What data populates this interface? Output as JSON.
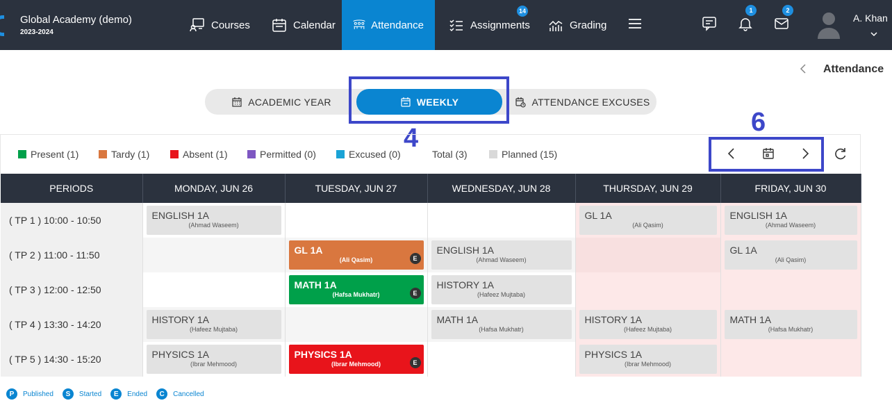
{
  "app": {
    "school_name": "Global Academy (demo)",
    "school_year": "2023-2024",
    "brand_color": "#0a85d1",
    "nav": [
      {
        "label": "Courses",
        "icon": "courses-icon"
      },
      {
        "label": "Calendar",
        "icon": "calendar-icon"
      },
      {
        "label": "Attendance",
        "icon": "attendance-icon",
        "active": true
      },
      {
        "label": "Assignments",
        "icon": "assignments-icon",
        "badge": "14"
      },
      {
        "label": "Grading",
        "icon": "grading-icon"
      }
    ],
    "header_badges": {
      "notifications": "1",
      "messages": "2"
    },
    "user_name": "A. Khan"
  },
  "breadcrumb": {
    "title": "Attendance"
  },
  "view_tabs": [
    {
      "label": "ACADEMIC YEAR",
      "icon": "calendar-grid-icon"
    },
    {
      "label": "WEEKLY",
      "icon": "calendar-icon",
      "active": true
    },
    {
      "label": "ATTENDANCE EXCUSES",
      "icon": "calendar-clock-icon"
    }
  ],
  "annotations": {
    "weekly": "4",
    "week_nav": "6"
  },
  "legend": [
    {
      "label": "Present (1)",
      "color": "#00a04a"
    },
    {
      "label": "Tardy (1)",
      "color": "#d9773f"
    },
    {
      "label": "Absent (1)",
      "color": "#e8141b"
    },
    {
      "label": "Permitted (0)",
      "color": "#7e57c2"
    },
    {
      "label": "Excused (0)",
      "color": "#1aa3d6"
    },
    {
      "label": "Total (3)",
      "color": ""
    },
    {
      "label": "Planned (15)",
      "color": "#d9d9d9"
    }
  ],
  "table": {
    "headers": [
      "PERIODS",
      "MONDAY, JUN 26",
      "TUESDAY, JUN 27",
      "WEDNESDAY, JUN 28",
      "THURSDAY, JUN 29",
      "FRIDAY, JUN 30"
    ],
    "rows": [
      {
        "period": "( TP 1 ) 10:00 - 10:50",
        "cells": [
          {
            "course": "ENGLISH 1A",
            "teacher": "(Ahmad Waseem)"
          },
          null,
          null,
          {
            "course": "GL 1A",
            "teacher": "(Ali Qasim)"
          },
          {
            "course": "ENGLISH 1A",
            "teacher": "(Ahmad Waseem)"
          }
        ]
      },
      {
        "period": "( TP 2 ) 11:00 - 11:50",
        "cells": [
          null,
          {
            "course": "GL 1A",
            "teacher": "(Ali Qasim)",
            "status": "tardy",
            "badge": "E"
          },
          {
            "course": "ENGLISH 1A",
            "teacher": "(Ahmad Waseem)"
          },
          null,
          {
            "course": "GL 1A",
            "teacher": "(Ali Qasim)"
          }
        ]
      },
      {
        "period": "( TP 3 ) 12:00 - 12:50",
        "cells": [
          null,
          {
            "course": "MATH 1A",
            "teacher": "(Hafsa Mukhatr)",
            "status": "present",
            "badge": "E"
          },
          {
            "course": "HISTORY 1A",
            "teacher": "(Hafeez Mujtaba)"
          },
          null,
          null
        ]
      },
      {
        "period": "( TP 4 ) 13:30 - 14:20",
        "cells": [
          {
            "course": "HISTORY 1A",
            "teacher": "(Hafeez Mujtaba)"
          },
          null,
          {
            "course": "MATH 1A",
            "teacher": "(Hafsa Mukhatr)"
          },
          {
            "course": "HISTORY 1A",
            "teacher": "(Hafeez Mujtaba)"
          },
          {
            "course": "MATH 1A",
            "teacher": "(Hafsa Mukhatr)"
          }
        ]
      },
      {
        "period": "( TP 5 ) 14:30 - 15:20",
        "cells": [
          {
            "course": "PHYSICS 1A",
            "teacher": "(Ibrar Mehmood)"
          },
          {
            "course": "PHYSICS 1A",
            "teacher": "(Ibrar Mehmood)",
            "status": "absent",
            "badge": "E"
          },
          null,
          {
            "course": "PHYSICS 1A",
            "teacher": "(Ibrar Mehmood)"
          },
          null
        ]
      }
    ]
  },
  "status_legend": [
    {
      "letter": "P",
      "label": "Published"
    },
    {
      "letter": "S",
      "label": "Started"
    },
    {
      "letter": "E",
      "label": "Ended"
    },
    {
      "letter": "C",
      "label": "Cancelled"
    }
  ]
}
